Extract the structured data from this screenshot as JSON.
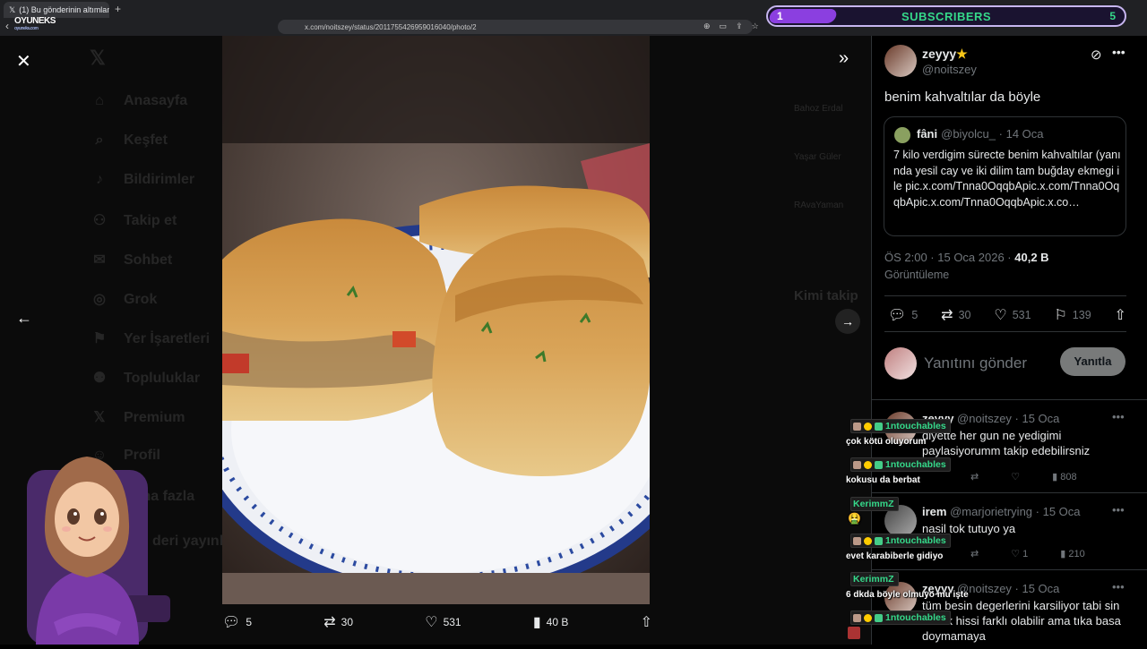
{
  "browser": {
    "tab_title": "(1) Bu gönderinin altımlamaları /",
    "url": "x.com/noitszey/status/2011755426959016040/photo/2",
    "logo_text": "OYUNEKS",
    "logo_sub": "oyuneks.com"
  },
  "stream_overlay": {
    "subscribers_label": "SUBSCRIBERS",
    "current": "1",
    "goal": "5"
  },
  "background_nav": {
    "items": [
      "Anasayfa",
      "Keşfet",
      "Bildirimler",
      "Takip et",
      "Sohbet",
      "Grok",
      "Yer İşaretleri",
      "Topluluklar",
      "Premium",
      "Profil",
      "Daha fazla",
      "deri yayınla"
    ],
    "right": [
      "Bahoz Erdal",
      "Yaşar Güler",
      "RAvaYaman",
      "Kimi takip"
    ]
  },
  "photo_actions": {
    "replies": "5",
    "reposts": "30",
    "likes": "531",
    "views": "40 B"
  },
  "tweet": {
    "author_name": "zeyyy",
    "author_handle": "@noitszey",
    "text": "benim kahvaltılar da böyle",
    "quote": {
      "name": "fâni",
      "handle": "@biyolcu_",
      "date": "· 14 Oca",
      "text": "7 kilo verdigim sürecte benim kahvaltılar (yanında yesil cay ve iki dilim tam buğday ekmegi ile pic.x.com/Tnna0OqqbApic.x.com/Tnna0OqqbApic.x.com/Tnna0OqqbApic.x.co…"
    },
    "timestamp": "ÖS 2:00 · 15 Oca 2026 ·",
    "views_count": "40,2 B",
    "views_label": "Görüntüleme",
    "stats": {
      "replies": "5",
      "reposts": "30",
      "likes": "531",
      "bookmarks": "139"
    },
    "reply_placeholder": "Yanıtını gönder",
    "reply_button": "Yanıtla"
  },
  "comments": [
    {
      "name": "zeyyy",
      "handle": "@noitszey · 15 Oca",
      "text": "diyette her gun ne yedigimi paylasiyorumm takip edebilirsniz",
      "views": "808"
    },
    {
      "name": "irem",
      "handle": "@marjorietrying · 15 Oca",
      "text": "nasil tok tutuyo ya",
      "likes": "1",
      "views": "210"
    },
    {
      "name": "zeyyy",
      "handle": "@noitszey · 15 Oca",
      "text": "tüm besin degerlerini karsiliyor tabi sin tokluk hissi farklı olabilir ama tıka basa doymamaya"
    }
  ],
  "chat": [
    {
      "user": "1ntouchables",
      "user_color": "#35d98a",
      "msg": "çok kötü oluyorum"
    },
    {
      "user": "1ntouchables",
      "user_color": "#35d98a",
      "msg": "kokusu da berbat"
    },
    {
      "user": "KerimmZ",
      "user_color": "#35d98a",
      "msg": "🤮"
    },
    {
      "user": "1ntouchables",
      "user_color": "#35d98a",
      "msg": "evet karabiberle gidiyo"
    },
    {
      "user": "KerimmZ",
      "user_color": "#35d98a",
      "msg": "6 dkda böyle olmuyo mu işte"
    },
    {
      "user": "1ntouchables",
      "user_color": "#35d98a",
      "msg": ""
    }
  ],
  "colors": {
    "accent": "#1d9bf0",
    "subs_green": "#35d98a",
    "subs_purple": "#8b3fe0"
  }
}
